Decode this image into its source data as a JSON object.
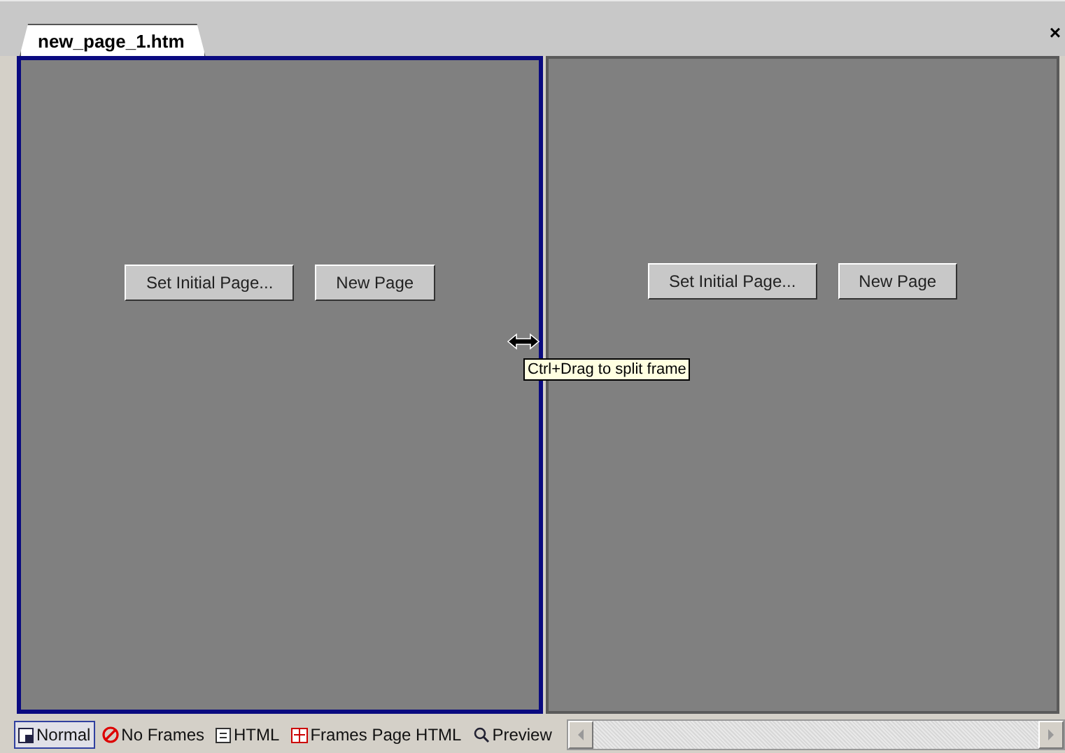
{
  "document_tabs": [
    {
      "label": "new_page_1.htm",
      "selected": true
    }
  ],
  "close_label": "×",
  "frames": [
    {
      "selected": true,
      "buttons": [
        "Set Initial Page...",
        "New Page"
      ]
    },
    {
      "selected": false,
      "buttons": [
        "Set Initial Page...",
        "New Page"
      ]
    }
  ],
  "tooltip": "Ctrl+Drag to split frame",
  "view_tabs": [
    {
      "label": "Normal",
      "kind": "normal",
      "selected": true
    },
    {
      "label": "No Frames",
      "kind": "noframes",
      "selected": false
    },
    {
      "label": "HTML",
      "kind": "html",
      "selected": false
    },
    {
      "label": "Frames Page HTML",
      "kind": "frameshtml",
      "selected": false
    },
    {
      "label": "Preview",
      "kind": "preview",
      "selected": false
    }
  ]
}
